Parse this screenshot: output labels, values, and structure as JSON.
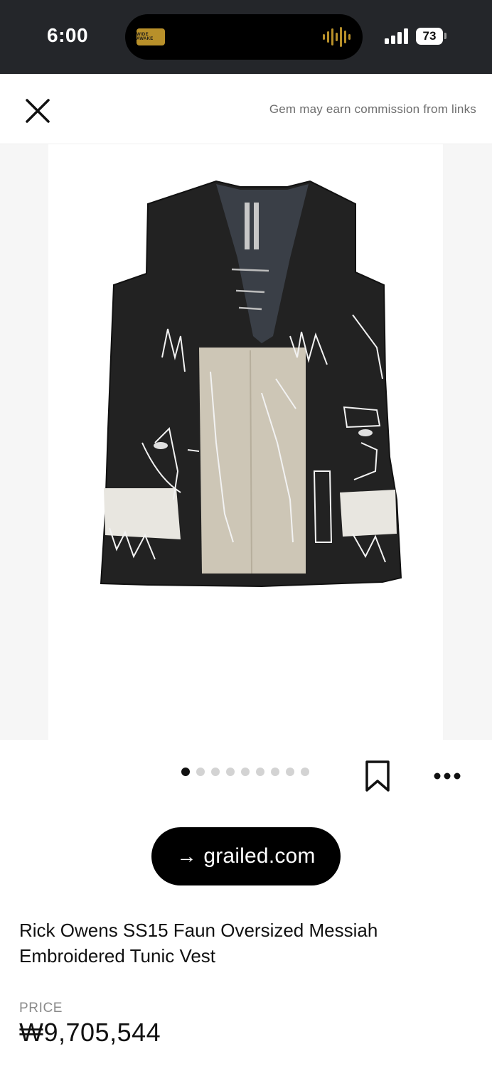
{
  "status_bar": {
    "time": "6:00",
    "now_playing_art_text": "WIDE AWAKE",
    "battery": "73"
  },
  "header": {
    "disclaimer": "Gem may earn commission from links"
  },
  "product_image": {
    "dot_count": 9,
    "active_index": 0
  },
  "source": {
    "arrow": "→",
    "label": "grailed.com"
  },
  "product": {
    "title": "Rick Owens SS15 Faun Oversized Messiah Embroidered Tunic Vest",
    "price_label": "PRICE",
    "price": "₩9,705,544"
  },
  "icons": {
    "close": "close-icon",
    "bookmark": "bookmark-icon",
    "more": "more-horizontal-icon"
  },
  "colors": {
    "status_bar_bg": "#24262a",
    "primary": "#000000",
    "muted_text": "#6e6e6e"
  }
}
